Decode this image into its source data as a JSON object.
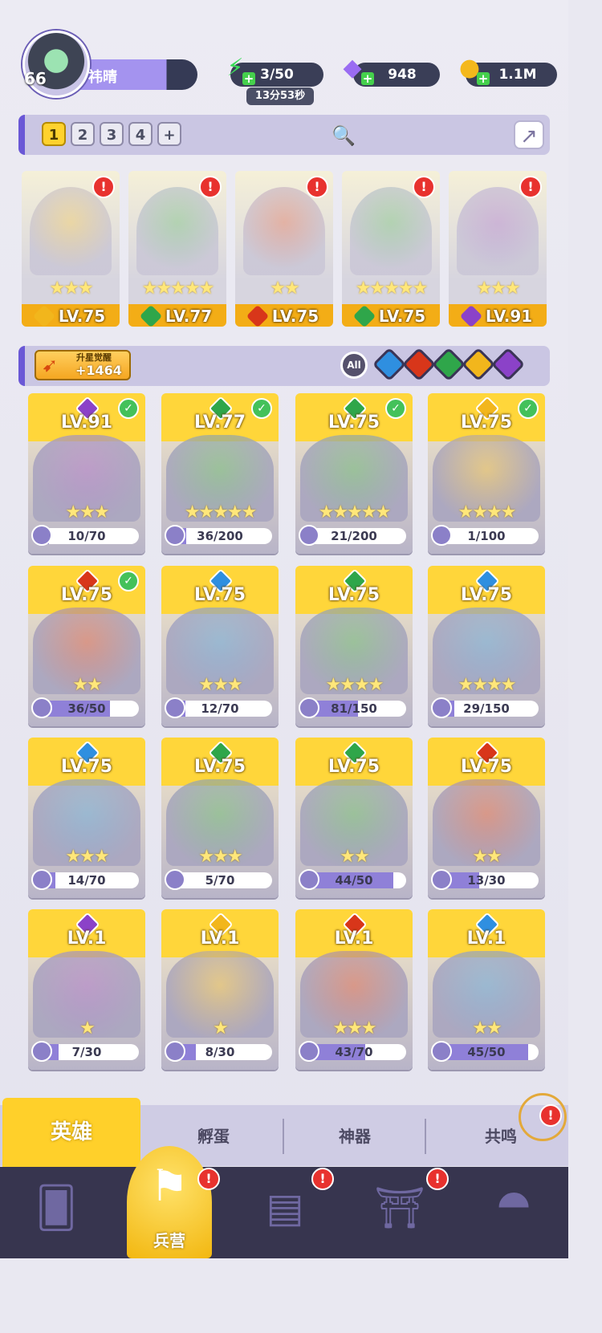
{
  "player": {
    "avatar_level": "66",
    "name": "祎晴"
  },
  "resources": {
    "energy": {
      "icon": "lightning-icon",
      "value": "3/50",
      "timer": "13分53秒"
    },
    "gems": {
      "icon": "gem-icon",
      "value": "948"
    },
    "coins": {
      "icon": "coin-icon",
      "value": "1.1M"
    }
  },
  "teams": {
    "tabs": [
      "1",
      "2",
      "3",
      "4",
      "+"
    ],
    "active_index": 0
  },
  "team_slots": [
    {
      "level": "LV.75",
      "element": "light",
      "stars": "★★★"
    },
    {
      "level": "LV.77",
      "element": "nature",
      "stars": "★★★★★"
    },
    {
      "level": "LV.75",
      "element": "fire",
      "stars": "★★"
    },
    {
      "level": "LV.75",
      "element": "nature",
      "stars": "★★★★★"
    },
    {
      "level": "LV.91",
      "element": "dark",
      "stars": "★★★"
    }
  ],
  "awaken": {
    "label": "升星觉醒",
    "value": "+1464"
  },
  "filters": {
    "all_label": "All",
    "elements": [
      "water",
      "fire",
      "nature",
      "light",
      "dark"
    ]
  },
  "element_colors": {
    "light": "#f2b61c",
    "nature": "#2fa64a",
    "fire": "#d8361a",
    "water": "#2f8fe0",
    "dark": "#8b42c8"
  },
  "heroes": [
    {
      "level": "LV.91",
      "element": "dark",
      "stars": "★★★",
      "shards": "10/70",
      "progress": 0.14,
      "check": true
    },
    {
      "level": "LV.77",
      "element": "nature",
      "stars": "★★★★★",
      "shards": "36/200",
      "progress": 0.18,
      "check": true
    },
    {
      "level": "LV.75",
      "element": "nature",
      "stars": "★★★★★",
      "shards": "21/200",
      "progress": 0.1,
      "check": true
    },
    {
      "level": "LV.75",
      "element": "light",
      "stars": "★★★★",
      "shards": "1/100",
      "progress": 0.01,
      "check": true
    },
    {
      "level": "LV.75",
      "element": "fire",
      "stars": "★★",
      "shards": "36/50",
      "progress": 0.72,
      "check": true
    },
    {
      "level": "LV.75",
      "element": "water",
      "stars": "★★★",
      "shards": "12/70",
      "progress": 0.17,
      "check": false
    },
    {
      "level": "LV.75",
      "element": "nature",
      "stars": "★★★★",
      "shards": "81/150",
      "progress": 0.54,
      "check": false
    },
    {
      "level": "LV.75",
      "element": "water",
      "stars": "★★★★",
      "shards": "29/150",
      "progress": 0.19,
      "check": false
    },
    {
      "level": "LV.75",
      "element": "water",
      "stars": "★★★",
      "shards": "14/70",
      "progress": 0.2,
      "check": false
    },
    {
      "level": "LV.75",
      "element": "nature",
      "stars": "★★★",
      "shards": "5/70",
      "progress": 0.07,
      "check": false
    },
    {
      "level": "LV.75",
      "element": "nature",
      "stars": "★★",
      "shards": "44/50",
      "progress": 0.88,
      "check": false
    },
    {
      "level": "LV.75",
      "element": "fire",
      "stars": "★★",
      "shards": "13/30",
      "progress": 0.43,
      "check": false
    },
    {
      "level": "LV.1",
      "element": "dark",
      "stars": "★",
      "shards": "7/30",
      "progress": 0.23,
      "check": false
    },
    {
      "level": "LV.1",
      "element": "light",
      "stars": "★",
      "shards": "8/30",
      "progress": 0.27,
      "check": false
    },
    {
      "level": "LV.1",
      "element": "fire",
      "stars": "★★★",
      "shards": "43/70",
      "progress": 0.61,
      "check": false
    },
    {
      "level": "LV.1",
      "element": "water",
      "stars": "★★",
      "shards": "45/50",
      "progress": 0.9,
      "check": false
    }
  ],
  "sub_tabs": [
    "英雄",
    "孵蛋",
    "神器",
    "共鸣"
  ],
  "nav": {
    "active_label": "兵营"
  }
}
